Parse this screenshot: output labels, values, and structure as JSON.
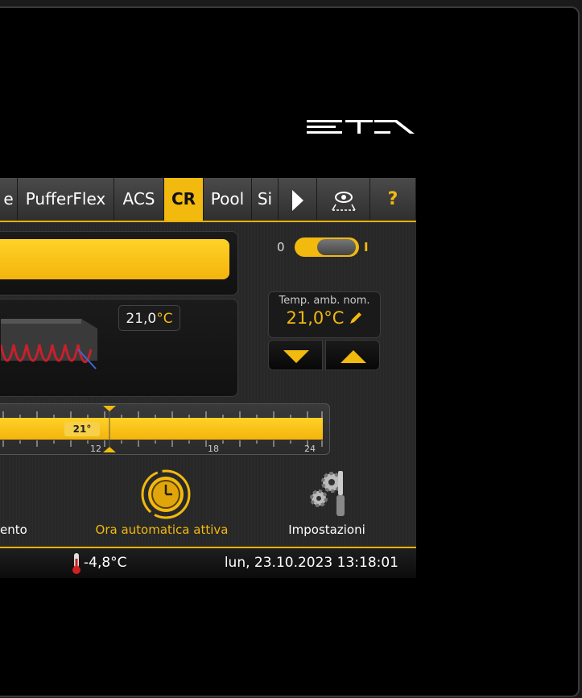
{
  "colors": {
    "accent": "#f2b90f",
    "background": "#000000",
    "panel": "#2a2a2a"
  },
  "tabs": [
    {
      "label": "e",
      "active": false
    },
    {
      "label": "PufferFlex",
      "active": false
    },
    {
      "label": "ACS",
      "active": false
    },
    {
      "label": "CR",
      "active": true
    },
    {
      "label": "Pool",
      "active": false
    },
    {
      "label": "Si",
      "active": false
    }
  ],
  "tab_icons": {
    "next": "play-arrow-icon",
    "view": "eye-icon",
    "help": "question-icon"
  },
  "help_label": "?",
  "toggle": {
    "off_label": "0",
    "on_label": "I",
    "state": "on"
  },
  "room": {
    "actual_value": "21,0",
    "actual_unit": "°C"
  },
  "setpoint": {
    "title": "Temp. amb. nom.",
    "value": "21,0°C"
  },
  "timeline": {
    "current_temp_label": "21°",
    "tick_labels": [
      "12",
      "18",
      "24"
    ]
  },
  "icons": [
    {
      "label": "ento",
      "icon": "partial-icon"
    },
    {
      "label": "Ora automatica attiva",
      "icon": "clock-icon",
      "highlight": true
    },
    {
      "label": "Impostazioni",
      "icon": "gears-icon"
    }
  ],
  "status": {
    "outdoor_temp": "-4,8°C",
    "datetime": "lun, 23.10.2023 13:18:01"
  }
}
